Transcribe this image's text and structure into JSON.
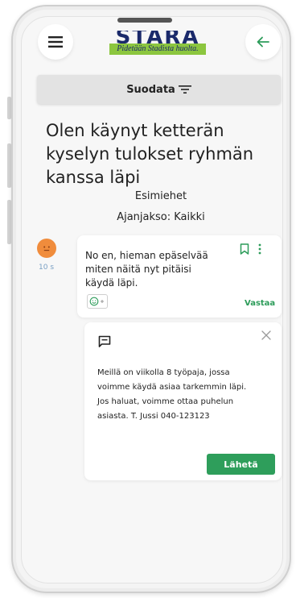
{
  "header": {
    "logo_letters": "STARA",
    "logo_tagline": "Pidetään Stadista huolta."
  },
  "filter": {
    "label": "Suodata"
  },
  "question": {
    "title": "Olen käynyt ketterän kyselyn tulokset ryhmän kanssa läpi",
    "group": "Esimiehet",
    "period": "Ajanjakso: Kaikki"
  },
  "message": {
    "time": "10 s",
    "text": "No en, hieman epäselvää miten näitä nyt pitäisi käydä läpi.",
    "reply_label": "Vastaa"
  },
  "reply": {
    "text": "Meillä on viikolla 8 työpaja, jossa voimme käydä asiaa tarkemmin läpi. Jos haluat, voimme ottaa puhelun asiasta. T. Jussi 040-123123",
    "send_label": "Lähetä"
  },
  "colors": {
    "accent": "#2e9e5b",
    "avatar": "#f08c3c",
    "filter_bg": "#e3e3e3"
  }
}
